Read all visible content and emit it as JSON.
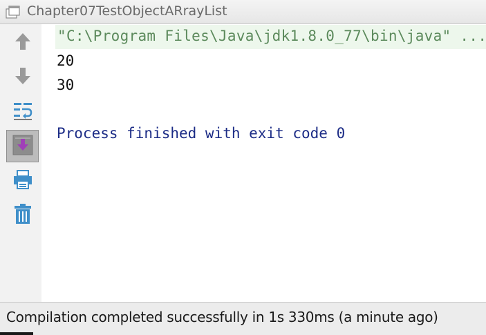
{
  "window": {
    "title": "Chapter07TestObjectARrayList",
    "icon": "run-console-icon"
  },
  "toolbar": {
    "buttons": [
      {
        "icon": "arrow-up-icon",
        "label": "Up the stack trace"
      },
      {
        "icon": "arrow-down-icon",
        "label": "Down the stack trace"
      },
      {
        "icon": "soft-wrap-icon",
        "label": "Use soft wraps"
      },
      {
        "icon": "scroll-to-end-icon",
        "label": "Scroll to the end",
        "pressed": true
      },
      {
        "icon": "print-icon",
        "label": "Print"
      },
      {
        "icon": "trash-icon",
        "label": "Clear all"
      }
    ]
  },
  "console": {
    "command": "\"C:\\Program Files\\Java\\jdk1.8.0_77\\bin\\java\" ...",
    "output": [
      "20",
      "30"
    ],
    "exit_message": "Process finished with exit code 0"
  },
  "status": {
    "message": "Compilation completed successfully in 1s 330ms (a minute ago)"
  },
  "colors": {
    "command_bg": "#edf7ec",
    "command_text": "#5c8a5c",
    "exit_text": "#1c2c86",
    "icon_blue": "#3f8fc9"
  }
}
